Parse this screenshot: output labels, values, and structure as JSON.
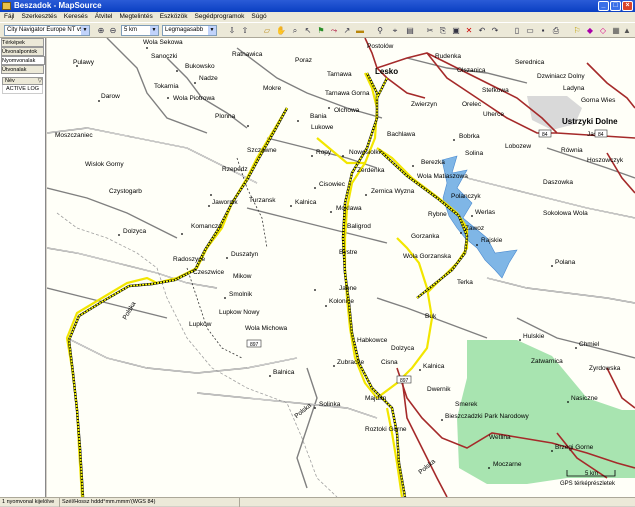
{
  "window": {
    "title": "Beszadok - MapSource",
    "minimize": "_",
    "maximize": "□",
    "close": "×"
  },
  "menu": [
    "Fájl",
    "Szerkesztés",
    "Keresés",
    "Átvitel",
    "Megtelintés",
    "Eszközök",
    "Segédprogramok",
    "Súgó"
  ],
  "toolbar": {
    "map_product": "City Navigator Europe NT v9",
    "zoom": "5 km",
    "detail": "Legmagasabb"
  },
  "sidebar": {
    "tabs": [
      "Térképek",
      "Útvonalpontok",
      "Nyomvonalak",
      "Útvonalak"
    ],
    "header_name": "Név",
    "items": [
      "ACTIVE LOG"
    ]
  },
  "map": {
    "places": [
      {
        "label": "Wola Sekowa"
      },
      {
        "label": "Sanoczki"
      },
      {
        "label": "Ratnawica"
      },
      {
        "label": "Poraz"
      },
      {
        "label": "Tarnawa"
      },
      {
        "label": "Postolów"
      },
      {
        "label": "Lesko"
      },
      {
        "label": "Rudenka"
      },
      {
        "label": "Olszanica"
      },
      {
        "label": "Serednica"
      },
      {
        "label": "Dzwiniacz Dolny"
      },
      {
        "label": "Pulawy"
      },
      {
        "label": "Bukowsko"
      },
      {
        "label": "Nadze"
      },
      {
        "label": "Tokarnia"
      },
      {
        "label": "Wola Piotrowa"
      },
      {
        "label": "Mokre"
      },
      {
        "label": "Tarnawa Gorna"
      },
      {
        "label": "Stefkowa"
      },
      {
        "label": "Ladyna"
      },
      {
        "label": "Gorna Wies"
      },
      {
        "label": "Darow"
      },
      {
        "label": "Plonna"
      },
      {
        "label": "Olchowa"
      },
      {
        "label": "Zwierzyn"
      },
      {
        "label": "Orelec"
      },
      {
        "label": "Uherce"
      },
      {
        "label": "Ustrzyki Dolne"
      },
      {
        "label": "Bania"
      },
      {
        "label": "Lukowe"
      },
      {
        "label": "Bachlawa"
      },
      {
        "label": "Bobrka"
      },
      {
        "label": "Jasien"
      },
      {
        "label": "Moszczaniec"
      },
      {
        "label": "Szczawne"
      },
      {
        "label": "Ropy"
      },
      {
        "label": "Nowosiolki"
      },
      {
        "label": "Solina"
      },
      {
        "label": "Lobozew"
      },
      {
        "label": "Równia"
      },
      {
        "label": "Wislok Gorny"
      },
      {
        "label": "Berezka"
      },
      {
        "label": "Hoszowczyk"
      },
      {
        "label": "Rzepedz"
      },
      {
        "label": "Zerdenka"
      },
      {
        "label": "Wola Matiaszowa"
      },
      {
        "label": "Czystogarb"
      },
      {
        "label": "Cisowiec"
      },
      {
        "label": "Zernica Wyzna"
      },
      {
        "label": "Polanczyk"
      },
      {
        "label": "Daszowka"
      },
      {
        "label": "Jawornik"
      },
      {
        "label": "Turzansk"
      },
      {
        "label": "Kalnica"
      },
      {
        "label": "Werlas"
      },
      {
        "label": "Sokolowa Wola"
      },
      {
        "label": "Moklawa"
      },
      {
        "label": "Rybne"
      },
      {
        "label": "Dolzyca"
      },
      {
        "label": "Komancza"
      },
      {
        "label": "Baligrod"
      },
      {
        "label": "Zawoz"
      },
      {
        "label": "Duszatyn"
      },
      {
        "label": "Gorzanka"
      },
      {
        "label": "Rajskie"
      },
      {
        "label": "Radoszyce"
      },
      {
        "label": "Bystre"
      },
      {
        "label": "Wola Gorzanska"
      },
      {
        "label": "Polana"
      },
      {
        "label": "Czeszwice"
      },
      {
        "label": "Mikow"
      },
      {
        "label": "Terka"
      },
      {
        "label": "Smolnik"
      },
      {
        "label": "Jabne"
      },
      {
        "label": "Kolonice"
      },
      {
        "label": "Lupkow Nowy"
      },
      {
        "label": "Wola Michowa"
      },
      {
        "label": "Buk"
      },
      {
        "label": "Lupkow"
      },
      {
        "label": "Hulskie"
      },
      {
        "label": "Habkowce"
      },
      {
        "label": "Chmiel"
      },
      {
        "label": "Dolzyca"
      },
      {
        "label": "Zubracze"
      },
      {
        "label": "Cisna"
      },
      {
        "label": "Zatwarnica"
      },
      {
        "label": "Balnica"
      },
      {
        "label": "Kalnica"
      },
      {
        "label": "Dwernik"
      },
      {
        "label": "Zyrdowska"
      },
      {
        "label": "Majdan"
      },
      {
        "label": "Solinka"
      },
      {
        "label": "Smerek"
      },
      {
        "label": "Nasiczne"
      },
      {
        "label": "Bieszczadzki Park Narodowy"
      },
      {
        "label": "Roztoki Gorne"
      },
      {
        "label": "Wetlina"
      },
      {
        "label": "Brzegi Gorne"
      },
      {
        "label": "Moczarne"
      },
      {
        "label": "Polska"
      },
      {
        "label": "Polska"
      },
      {
        "label": "Polska"
      }
    ],
    "road_shields": [
      "84",
      "84",
      "897",
      "897"
    ],
    "scale_label": "5 km",
    "copyright": "GPS térképrészletek"
  },
  "status": {
    "selection": "1 nyomvonal kijelölve",
    "position": "Szél/Hossz hddd°mm.mmm'(WGS 84)"
  }
}
